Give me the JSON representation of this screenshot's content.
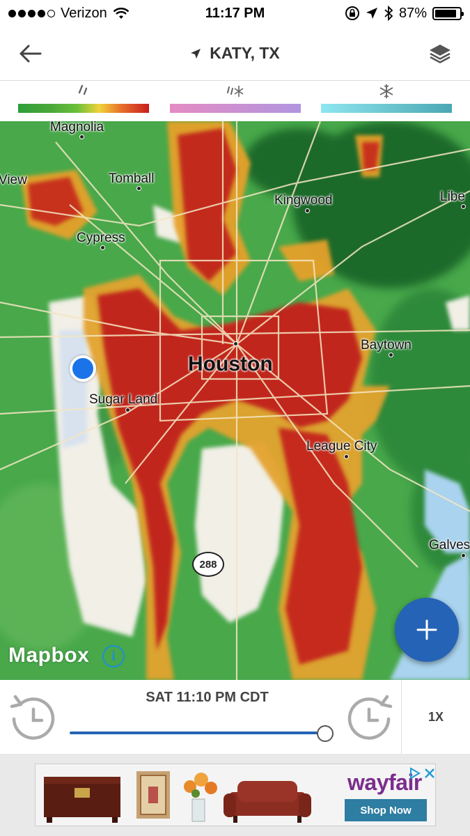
{
  "status_bar": {
    "carrier": "Verizon",
    "time": "11:17 PM",
    "battery": "87%"
  },
  "nav": {
    "title": "KATY, TX",
    "back_icon": "arrow-left-icon",
    "location_icon": "location-arrow-icon",
    "layers_icon": "layers-icon"
  },
  "legend": [
    {
      "icon": "rain-icon",
      "colors": [
        "#2e9e3a",
        "#6bbf3a",
        "#f1d33b",
        "#e8732a",
        "#c81e1e"
      ]
    },
    {
      "icon": "mixed-icon",
      "colors": [
        "#e58bc3",
        "#b195e0"
      ]
    },
    {
      "icon": "snowflake-icon",
      "colors": [
        "#8ee6f0",
        "#4aa7b3"
      ]
    }
  ],
  "map": {
    "cities": [
      {
        "name": "Magnolia",
        "big": false
      },
      {
        "name": "View",
        "big": false
      },
      {
        "name": "Tomball",
        "big": false
      },
      {
        "name": "Kingwood",
        "big": false
      },
      {
        "name": "Libe",
        "big": false
      },
      {
        "name": "Cypress",
        "big": false
      },
      {
        "name": "Houston",
        "big": true
      },
      {
        "name": "Baytown",
        "big": false
      },
      {
        "name": "Sugar Land",
        "big": false
      },
      {
        "name": "League City",
        "big": false
      },
      {
        "name": "Galves",
        "big": false
      }
    ],
    "highway_shield": "288",
    "attribution": "Mapbox",
    "info_icon": "info-icon",
    "fab_icon": "plus-icon"
  },
  "timeline": {
    "timestamp": "SAT 11:10 PM CDT",
    "progress": 1.0,
    "speed": "1X",
    "rewind_icon": "rewind-clock-icon",
    "forward_icon": "forward-clock-icon"
  },
  "ad": {
    "brand": "wayfair",
    "cta": "Shop Now"
  }
}
